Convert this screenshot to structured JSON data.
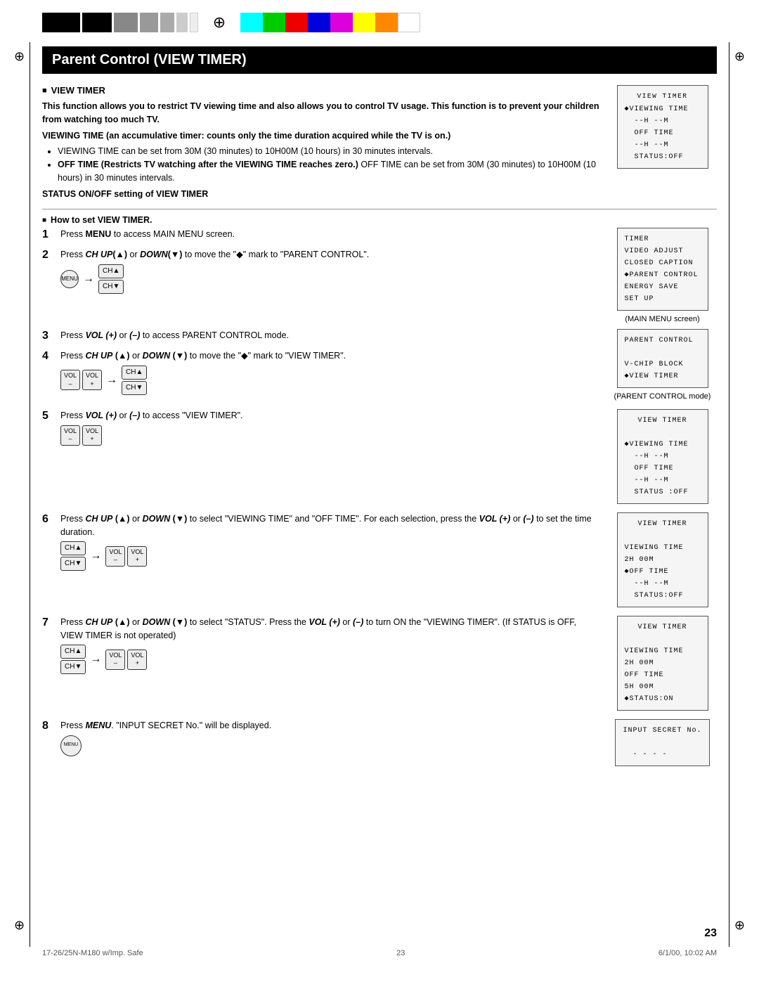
{
  "page": {
    "title": "Parent Control (VIEW TIMER)",
    "page_number": "23",
    "footer_left": "17-26/25N-M180 w/Imp. Safe",
    "footer_center": "23",
    "footer_right": "6/1/00, 10:02 AM"
  },
  "color_swatches": [
    "#00ffff",
    "#00ff00",
    "#ff0000",
    "#0000ff",
    "#ff00ff",
    "#ffff00",
    "#ff8800",
    "#ffffff"
  ],
  "black_bars": [
    56,
    44,
    36,
    28,
    22,
    18,
    14
  ],
  "section1": {
    "header": "VIEW TIMER",
    "intro_bold": "This function allows you to restrict TV viewing time and also allows you to control TV usage. This function is to prevent your children from watching too much TV.",
    "viewing_time_header": "VIEWING TIME (an accumulative timer: counts only the time duration acquired while the TV is on.)",
    "bullets": [
      "VIEWING TIME can be set from 30M (30 minutes) to 10H00M (10 hours) in 30 minutes intervals.",
      "OFF TIME (Restricts TV watching after the VIEWING TIME reaches zero.) OFF TIME can be set from 30M (30 minutes) to 10H00M (10 hours) in 30 minutes intervals.",
      "STATUS ON/OFF setting of VIEW TIMER"
    ],
    "screen1": {
      "title": "VIEW TIMER",
      "lines": [
        "◆VIEWING TIME",
        "  --H --M",
        "  OFF TIME",
        "  --H --M",
        "  STATUS:OFF"
      ]
    }
  },
  "section2": {
    "header": "How to set VIEW TIMER.",
    "steps": [
      {
        "number": "1",
        "text": "Press MENU to access MAIN MENU screen."
      },
      {
        "number": "2",
        "text": "Press CH UP(▲) or DOWN(▼) to move the \"◆\" mark to \"PARENT CONTROL\".",
        "screen": {
          "title": "TIMER",
          "lines": [
            "VIDEO ADJUST",
            "CLOSED CAPTION",
            "◆PARENT CONTROL",
            "ENERGY SAVE",
            "SET UP"
          ]
        },
        "screen_caption": "(MAIN MENU screen)"
      },
      {
        "number": "3",
        "text": "Press VOL (+) or (–) to access PARENT CONTROL mode."
      },
      {
        "number": "4",
        "text": "Press CH UP (▲) or DOWN (▼) to move the \"◆\" mark to \"VIEW TIMER\".",
        "screen": {
          "title": "PARENT CONTROL",
          "lines": [
            "",
            "V-CHIP BLOCK",
            "◆VIEW TIMER"
          ]
        },
        "screen_caption": "(PARENT CONTROL mode)"
      },
      {
        "number": "5",
        "text": "Press VOL (+) or (–) to access \"VIEW TIMER\".",
        "screen": {
          "title": "VIEW TIMER",
          "lines": [
            "◆VIEWING TIME",
            "  --H --M",
            "  OFF TIME",
            "  --H --M",
            "  STATUS :OFF"
          ]
        }
      },
      {
        "number": "6",
        "text": "Press CH UP (▲) or DOWN (▼) to select \"VIEWING TIME\" and \"OFF TIME\". For each selection, press the VOL (+) or (–) to set the time duration.",
        "screen": {
          "title": "VIEW TIMER",
          "lines": [
            "",
            "VIEWING TIME",
            "2H 00M",
            "◆OFF TIME",
            "  --H --M",
            "  STATUS:OFF"
          ]
        }
      },
      {
        "number": "7",
        "text": "Press CH UP (▲) or DOWN (▼) to select \"STATUS\". Press the VOL (+) or (–) to turn ON the \"VIEWING TIMER\". (If STATUS is OFF, VIEW TIMER is not operated)",
        "screen": {
          "title": "VIEW TIMER",
          "lines": [
            "",
            "VIEWING TIME",
            "2H 00M",
            "OFF TIME",
            "5H 00M",
            "◆STATUS:ON"
          ]
        }
      },
      {
        "number": "8",
        "text": "Press MENU. \"INPUT SECRET No.\" will be displayed.",
        "screen": {
          "title": "INPUT SECRET No.",
          "lines": [
            "",
            "  - - - -"
          ]
        }
      }
    ]
  },
  "buttons": {
    "cha_up": "CH▲",
    "cha_down": "CH▼",
    "vol_minus": "VOL\n–",
    "vol_plus": "VOL\n+",
    "menu": "MENU",
    "arrow": "→"
  }
}
